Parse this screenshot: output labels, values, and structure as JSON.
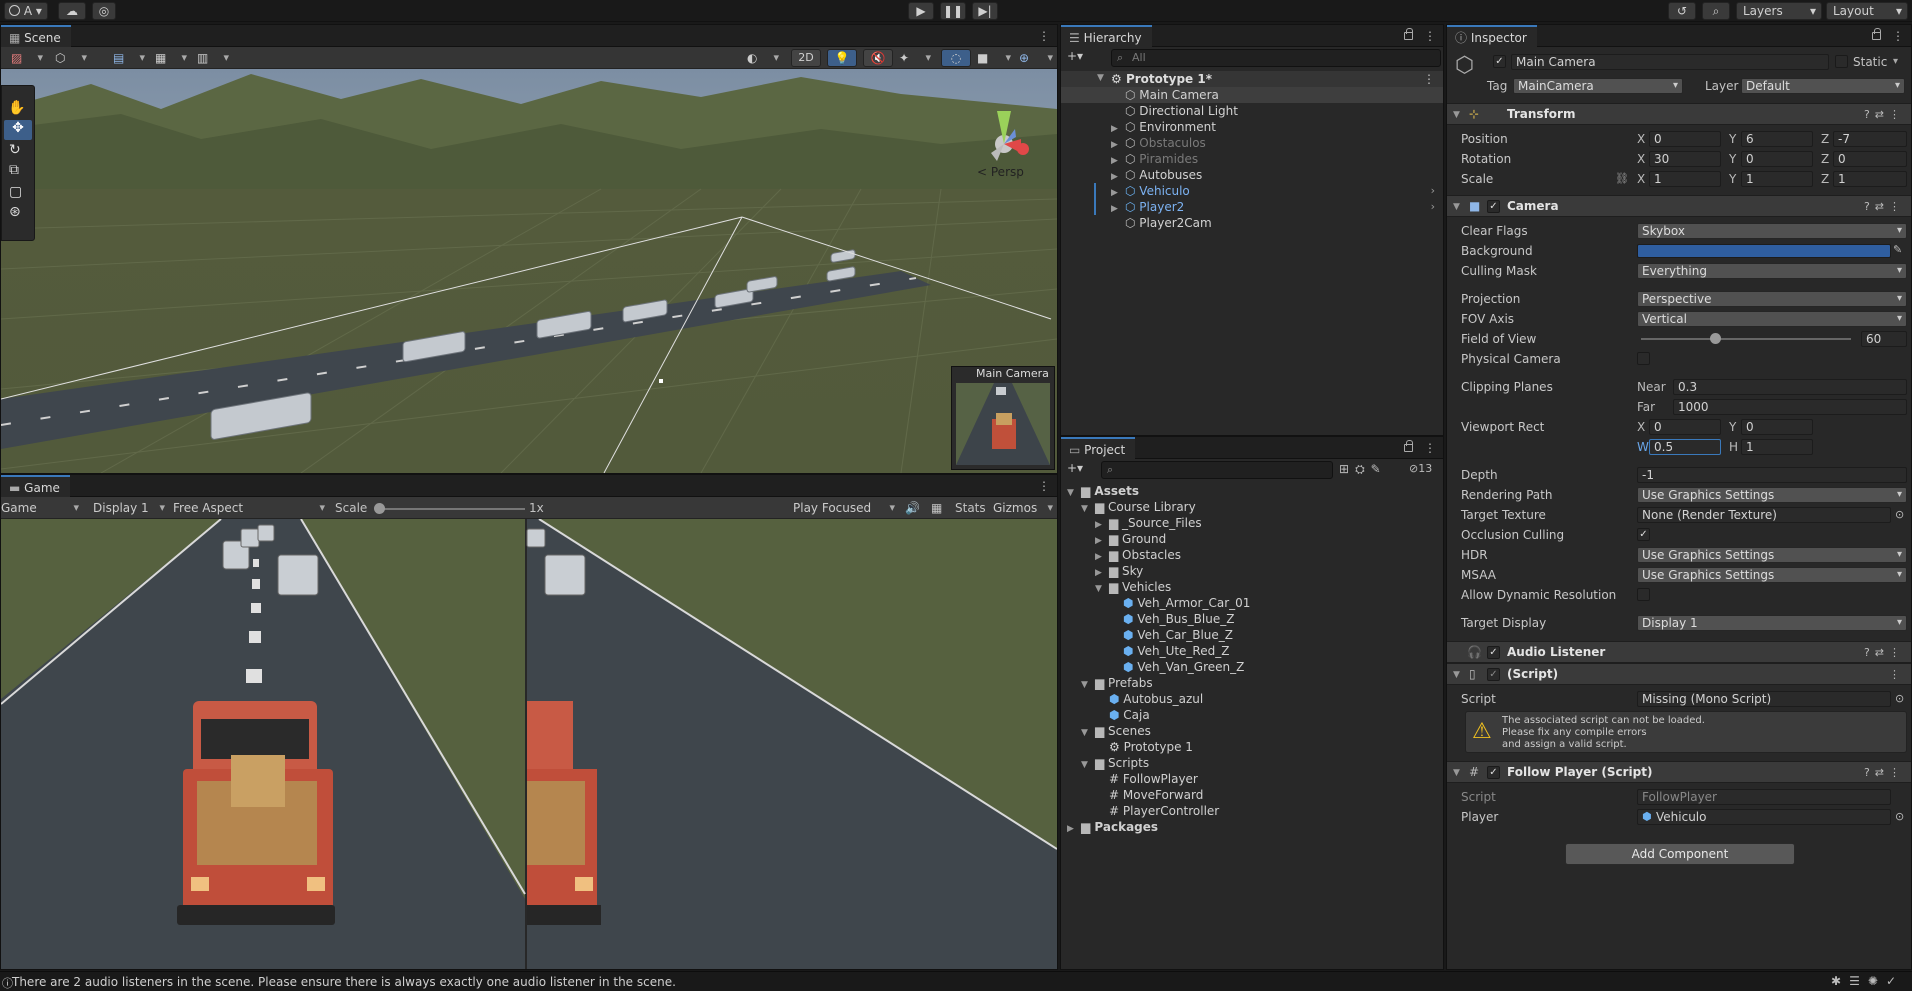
{
  "topbar": {
    "account_label": "A",
    "layers_label": "Layers",
    "layout_label": "Layout"
  },
  "scene": {
    "tab_label": "Scene",
    "mode_2d": "2D",
    "persp_label": "Persp",
    "camera_preview_label": "Main Camera"
  },
  "game": {
    "tab_label": "Game",
    "view_dropdown": "Game",
    "display_dropdown": "Display 1",
    "aspect_dropdown": "Free Aspect",
    "scale_label": "Scale",
    "scale_value": "1x",
    "play_mode_dropdown": "Play Focused",
    "stats_label": "Stats",
    "gizmos_label": "Gizmos"
  },
  "hierarchy": {
    "tab_label": "Hierarchy",
    "search_placeholder": "All",
    "scene_name": "Prototype 1*",
    "items": [
      {
        "label": "Main Camera",
        "type": "object",
        "expand": false,
        "color": "#d2d2d2",
        "selected": true
      },
      {
        "label": "Directional Light",
        "type": "object",
        "expand": false,
        "color": "#d2d2d2"
      },
      {
        "label": "Environment",
        "type": "object",
        "expand": true,
        "color": "#d2d2d2"
      },
      {
        "label": "Obstaculos",
        "type": "object",
        "expand": true,
        "color": "#7a7a7a"
      },
      {
        "label": "Piramides",
        "type": "object",
        "expand": true,
        "color": "#7a7a7a"
      },
      {
        "label": "Autobuses",
        "type": "object",
        "expand": true,
        "color": "#d2d2d2"
      },
      {
        "label": "Vehiculo",
        "type": "prefab",
        "expand": true,
        "color": "#7cb2f2"
      },
      {
        "label": "Player2",
        "type": "prefab",
        "expand": true,
        "color": "#7cb2f2"
      },
      {
        "label": "Player2Cam",
        "type": "object",
        "expand": false,
        "color": "#d2d2d2"
      }
    ]
  },
  "project": {
    "tab_label": "Project",
    "hidden_count": "13",
    "tree": [
      {
        "label": "Assets",
        "icon": "folder",
        "depth": 0,
        "open": true,
        "bold": true
      },
      {
        "label": "Course Library",
        "icon": "folder",
        "depth": 1,
        "open": true
      },
      {
        "label": "_Source_Files",
        "icon": "folder",
        "depth": 2,
        "open": false
      },
      {
        "label": "Ground",
        "icon": "folder",
        "depth": 2,
        "open": false
      },
      {
        "label": "Obstacles",
        "icon": "folder",
        "depth": 2,
        "open": false
      },
      {
        "label": "Sky",
        "icon": "folder",
        "depth": 2,
        "open": false
      },
      {
        "label": "Vehicles",
        "icon": "folder",
        "depth": 2,
        "open": true
      },
      {
        "label": "Veh_Armor_Car_01",
        "icon": "prefab",
        "depth": 3
      },
      {
        "label": "Veh_Bus_Blue_Z",
        "icon": "prefab",
        "depth": 3
      },
      {
        "label": "Veh_Car_Blue_Z",
        "icon": "prefab",
        "depth": 3
      },
      {
        "label": "Veh_Ute_Red_Z",
        "icon": "prefab",
        "depth": 3
      },
      {
        "label": "Veh_Van_Green_Z",
        "icon": "prefab",
        "depth": 3
      },
      {
        "label": "Prefabs",
        "icon": "folder",
        "depth": 1,
        "open": true
      },
      {
        "label": "Autobus_azul",
        "icon": "prefab",
        "depth": 2
      },
      {
        "label": "Caja",
        "icon": "prefab",
        "depth": 2
      },
      {
        "label": "Scenes",
        "icon": "folder",
        "depth": 1,
        "open": true
      },
      {
        "label": "Prototype 1",
        "icon": "scene",
        "depth": 2
      },
      {
        "label": "Scripts",
        "icon": "folder",
        "depth": 1,
        "open": true
      },
      {
        "label": "FollowPlayer",
        "icon": "script",
        "depth": 2
      },
      {
        "label": "MoveForward",
        "icon": "script",
        "depth": 2
      },
      {
        "label": "PlayerController",
        "icon": "script",
        "depth": 2
      },
      {
        "label": "Packages",
        "icon": "folder",
        "depth": 0,
        "open": false,
        "bold": true
      }
    ]
  },
  "inspector": {
    "tab_label": "Inspector",
    "object_name": "Main Camera",
    "static_label": "Static",
    "tag_label": "Tag",
    "tag_value": "MainCamera",
    "layer_label": "Layer",
    "layer_value": "Default",
    "transform": {
      "title": "Transform",
      "position_label": "Position",
      "pos_x": "0",
      "pos_y": "6",
      "pos_z": "-7",
      "rotation_label": "Rotation",
      "rot_x": "30",
      "rot_y": "0",
      "rot_z": "0",
      "scale_label": "Scale",
      "scale_x": "1",
      "scale_y": "1",
      "scale_z": "1"
    },
    "camera": {
      "title": "Camera",
      "clear_flags_label": "Clear Flags",
      "clear_flags": "Skybox",
      "background_label": "Background",
      "background_color": "#2f5ea0",
      "culling_mask_label": "Culling Mask",
      "culling_mask": "Everything",
      "projection_label": "Projection",
      "projection": "Perspective",
      "fov_axis_label": "FOV Axis",
      "fov_axis": "Vertical",
      "fov_label": "Field of View",
      "fov_value": "60",
      "fov_fraction": 0.35,
      "physical_label": "Physical Camera",
      "clipping_label": "Clipping Planes",
      "near_label": "Near",
      "near": "0.3",
      "far_label": "Far",
      "far": "1000",
      "viewport_label": "Viewport Rect",
      "vp_x": "0",
      "vp_y": "0",
      "vp_w": "0.5",
      "vp_h": "1",
      "depth_label": "Depth",
      "depth": "-1",
      "rendering_path_label": "Rendering Path",
      "rendering_path": "Use Graphics Settings",
      "target_texture_label": "Target Texture",
      "target_texture": "None (Render Texture)",
      "occlusion_label": "Occlusion Culling",
      "hdr_label": "HDR",
      "hdr": "Use Graphics Settings",
      "msaa_label": "MSAA",
      "msaa": "Use Graphics Settings",
      "dynamic_res_label": "Allow Dynamic Resolution",
      "target_display_label": "Target Display",
      "target_display": "Display 1"
    },
    "audio_listener": {
      "title": "Audio Listener"
    },
    "missing_script": {
      "title": "(Script)",
      "script_label": "Script",
      "script_value": "Missing (Mono Script)",
      "warning_line1": "The associated script can not be loaded.",
      "warning_line2": "Please fix any compile errors",
      "warning_line3": "and assign a valid script."
    },
    "follow_player": {
      "title": "Follow Player (Script)",
      "script_label": "Script",
      "script_value": "FollowPlayer",
      "player_label": "Player",
      "player_value": "Vehiculo"
    },
    "add_component_label": "Add Component"
  },
  "statusbar": {
    "message": "There are 2 audio listeners in the scene. Please ensure there is always exactly one audio listener in the scene."
  }
}
